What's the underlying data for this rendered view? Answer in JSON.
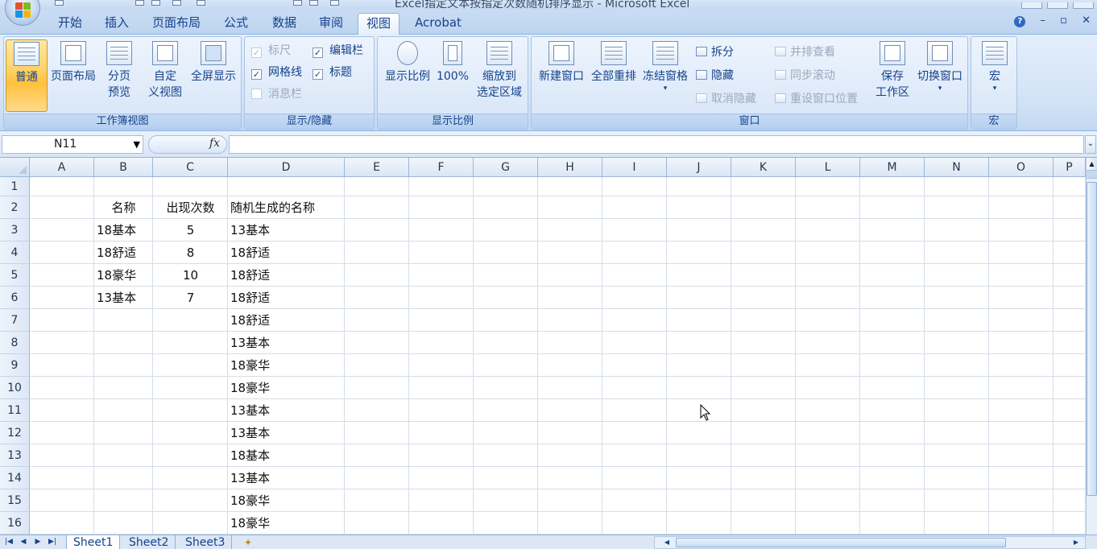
{
  "window": {
    "title": "Excel指定文本按指定次数随机排序显示 - Microsoft Excel"
  },
  "ribbon_tabs": [
    "开始",
    "插入",
    "页面布局",
    "公式",
    "数据",
    "审阅",
    "视图",
    "Acrobat"
  ],
  "active_tab": "视图",
  "groups": {
    "workbook_views": {
      "label": "工作簿视图",
      "normal": "普通",
      "page_layout": "页面布局",
      "page_break_1": "分页",
      "page_break_2": "预览",
      "custom_1": "自定",
      "custom_2": "义视图",
      "fullscreen": "全屏显示"
    },
    "show_hide": {
      "label": "显示/隐藏",
      "ruler": "标尺",
      "formula_bar": "编辑栏",
      "gridlines": "网格线",
      "headings": "标题",
      "message_bar": "消息栏",
      "check_mark": "✓"
    },
    "zoom": {
      "label": "显示比例",
      "zoom": "显示比例",
      "hundred": "100%",
      "zoom_sel_1": "缩放到",
      "zoom_sel_2": "选定区域"
    },
    "window": {
      "label": "窗口",
      "new_window": "新建窗口",
      "arrange_all": "全部重排",
      "freeze_panes": "冻结窗格",
      "split": "拆分",
      "hide": "隐藏",
      "unhide": "取消隐藏",
      "side_by_side": "并排查看",
      "sync_scroll": "同步滚动",
      "reset_pos": "重设窗口位置",
      "save_ws_1": "保存",
      "save_ws_2": "工作区",
      "switch_windows": "切换窗口"
    },
    "macros": {
      "label": "宏",
      "macros": "宏"
    }
  },
  "formula_bar": {
    "name_box": "N11",
    "fx": "fx",
    "formula": ""
  },
  "columns": [
    "A",
    "B",
    "C",
    "D",
    "E",
    "F",
    "G",
    "H",
    "I",
    "J",
    "K",
    "L",
    "M",
    "N",
    "O",
    "P"
  ],
  "rows": [
    "1",
    "2",
    "3",
    "4",
    "5",
    "6",
    "7",
    "8",
    "9",
    "10",
    "11",
    "12",
    "13",
    "14",
    "15",
    "16"
  ],
  "cells": {
    "B2": "名称",
    "C2": "出现次数",
    "D2": "随机生成的名称",
    "B3": "18基本",
    "C3": "5",
    "D3": "13基本",
    "B4": "18舒适",
    "C4": "8",
    "D4": "18舒适",
    "B5": "18豪华",
    "C5": "10",
    "D5": "18舒适",
    "B6": "13基本",
    "C6": "7",
    "D6": "18舒适",
    "D7": "18舒适",
    "D8": "13基本",
    "D9": "18豪华",
    "D10": "18豪华",
    "D11": "13基本",
    "D12": "13基本",
    "D13": "18基本",
    "D14": "13基本",
    "D15": "18豪华",
    "D16": "18豪华"
  },
  "sheets": [
    "Sheet1",
    "Sheet2",
    "Sheet3"
  ],
  "active_sheet": "Sheet1",
  "nav_arrows": [
    "|◀",
    "◀",
    "▶",
    "▶|"
  ],
  "colors": {
    "ribbon_text": "#15428b",
    "active_button": "#ffc13b",
    "header_border": "#9eb6d6"
  }
}
